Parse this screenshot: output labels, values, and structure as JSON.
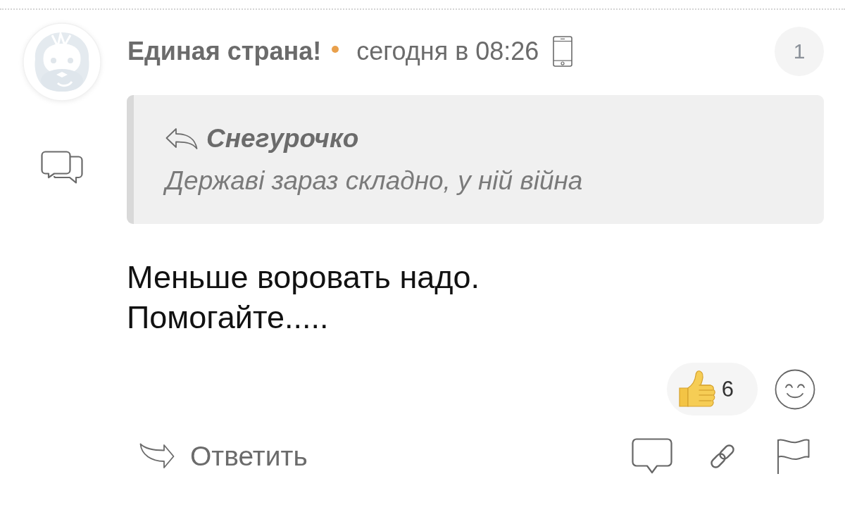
{
  "comment": {
    "author": "Единая страна!",
    "time": "сегодня в 08:26",
    "number": "1",
    "quote": {
      "author": "Снегурочко",
      "text": "Державі зараз складно, у ній війна"
    },
    "text_lines": [
      "Меньше воровать надо.",
      "Помогайте....."
    ],
    "reactions": [
      {
        "kind": "like",
        "count": "6"
      }
    ],
    "actions": {
      "reply_label": "Ответить"
    }
  }
}
